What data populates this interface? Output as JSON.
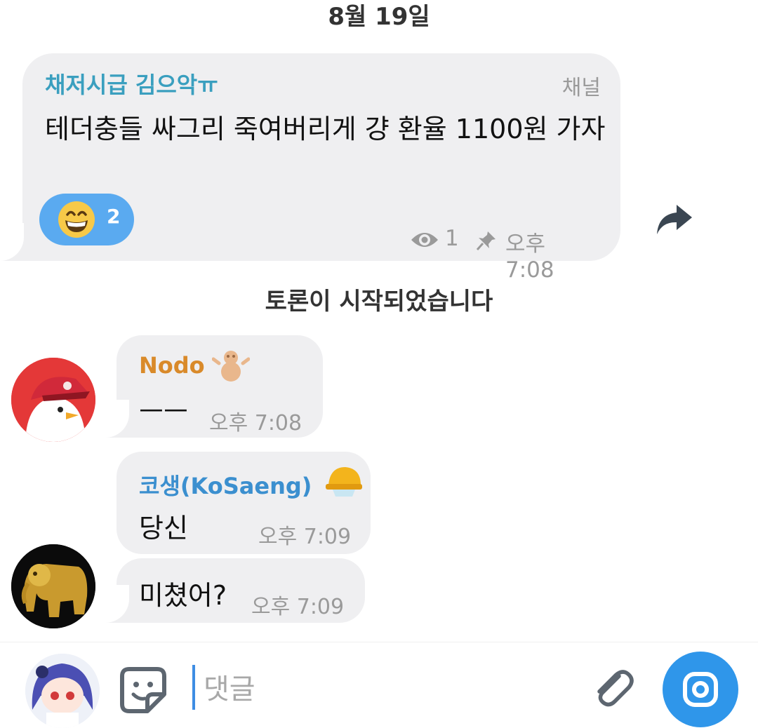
{
  "date_header": "8월 19일",
  "channel_post": {
    "author": "채저시급 김으악ㅠ",
    "label": "채널",
    "text": "테더충들 싸그리 죽여버리게 걍 환율 1100원 가자",
    "reaction": {
      "icon": "grinning-face-emoji",
      "count": "2"
    },
    "views": "1",
    "time": "오후 7:08",
    "colors": {
      "author": "#3a9fbf",
      "reaction_bg": "#5aaaf0"
    }
  },
  "system_message": "토론이 시작되었습니다",
  "messages": [
    {
      "author": "Nodo",
      "author_badge": "snowman-badge-icon",
      "text": "ㅡㅡ",
      "time": "오후 7:08",
      "author_color": "#d98a2a"
    },
    {
      "author": "코생(KoSaeng)",
      "author_badge": "hard-hat-badge-icon",
      "text": "당신",
      "time": "오후 7:09",
      "author_color": "#3b8fcf"
    },
    {
      "text": "미쳤어?",
      "time": "오후 7:09"
    }
  ],
  "composer": {
    "placeholder": "댓글",
    "accent": "#2f96ea"
  }
}
